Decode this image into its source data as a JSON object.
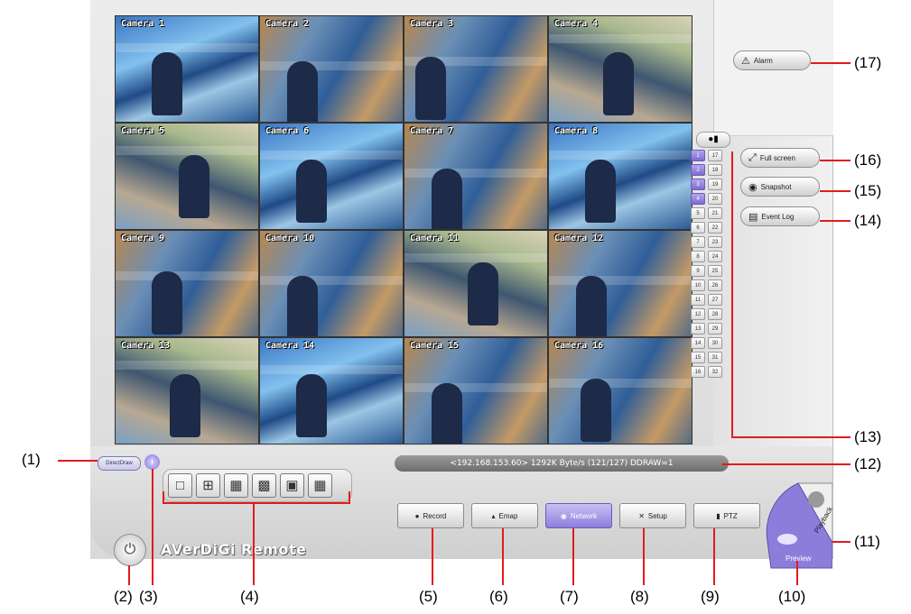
{
  "cameras": [
    {
      "label": "Camera 1"
    },
    {
      "label": "Camera 2"
    },
    {
      "label": "Camera 3"
    },
    {
      "label": "Camera 4"
    },
    {
      "label": "Camera 5"
    },
    {
      "label": "Camera 6"
    },
    {
      "label": "Camera 7"
    },
    {
      "label": "Camera 8"
    },
    {
      "label": "Camera 9"
    },
    {
      "label": "Camera 10"
    },
    {
      "label": "Camera 11"
    },
    {
      "label": "Camera 12"
    },
    {
      "label": "Camera 13"
    },
    {
      "label": "Camera 14"
    },
    {
      "label": "Camera 15"
    },
    {
      "label": "Camera 16"
    }
  ],
  "channels": {
    "left": [
      "1",
      "2",
      "3",
      "4",
      "5",
      "6",
      "7",
      "8",
      "9",
      "10",
      "11",
      "12",
      "13",
      "14",
      "15",
      "16"
    ],
    "right": [
      "17",
      "18",
      "19",
      "20",
      "21",
      "22",
      "23",
      "24",
      "25",
      "26",
      "27",
      "28",
      "29",
      "30",
      "31",
      "32"
    ],
    "active": [
      "1",
      "2",
      "3",
      "4"
    ]
  },
  "side_buttons": {
    "alarm": "Alarm",
    "fullscreen": "Full screen",
    "snapshot": "Snapshot",
    "eventlog": "Event Log"
  },
  "status_text": "<192.168.153.60> 1292K Byte/s (121/127) DDRAW=1",
  "directdraw_label": "DirectDraw",
  "logo": "AVerDiGi Remote",
  "functions": {
    "record": "Record",
    "emap": "Emap",
    "network": "Network",
    "setup": "Setup",
    "ptz": "PTZ"
  },
  "mode": {
    "playback": "Playback",
    "preview": "Preview"
  },
  "callouts": {
    "c1": "(1)",
    "c2": "(2)",
    "c3": "(3)",
    "c4": "(4)",
    "c5": "(5)",
    "c6": "(6)",
    "c7": "(7)",
    "c8": "(8)",
    "c9": "(9)",
    "c10": "(10)",
    "c11": "(11)",
    "c12": "(12)",
    "c13": "(13)",
    "c14": "(14)",
    "c15": "(15)",
    "c16": "(16)",
    "c17": "(17)"
  },
  "colors": {
    "accent": "#8d7ddb",
    "callout_line": "#e31b1b",
    "status_bg": "#7d7d7d"
  }
}
